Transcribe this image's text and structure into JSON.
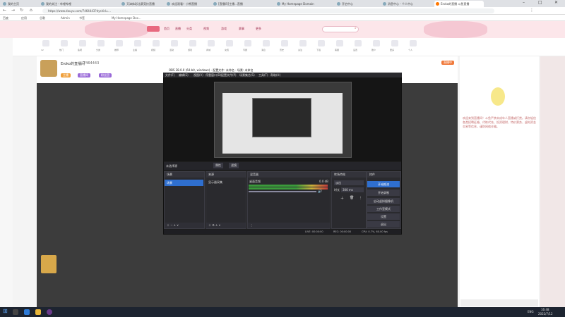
{
  "browser": {
    "tabs": [
      {
        "label": "我的主页"
      },
      {
        "label": "我的关注 - 哔哩哔哩"
      },
      {
        "label": "天津体彩比赛竞技直播"
      },
      {
        "label": "欢迎观看！小熊直播"
      },
      {
        "label": "[直播间]主播...直播"
      },
      {
        "label": "My Homepage Domain"
      },
      {
        "label": "开启中心"
      },
      {
        "label": "消息中心 - 个人中心"
      },
      {
        "label": "Eroko的直播 斗鱼直播"
      }
    ],
    "url": "https://www.douyu.com/7464443?dyshid=...",
    "bookmarks": [
      "百度",
      "应用",
      "谷歌",
      "Admin",
      "书签",
      "My Homepage Doc..."
    ]
  },
  "site": {
    "nav": [
      "首页",
      "直播",
      "分类",
      "视频",
      "游戏",
      "赛事",
      "更多"
    ],
    "icon_row": [
      "12",
      "热门",
      "鱼吧",
      "分类",
      "推荐",
      "主播",
      "视频",
      "活动",
      "游戏",
      "商城",
      "充值",
      "专属",
      "消息",
      "历史",
      "关注",
      "下载",
      "客服",
      "设置",
      "账户",
      "更多",
      "个人"
    ],
    "room": {
      "name": "Eroko的直播间",
      "id": "7464443",
      "tag1": "主播",
      "tag2": "直播间",
      "tag3": "粉丝团"
    },
    "side_text": "欢迎来到直播间！斗鱼严禁未成年人直播或打赏。请勿轻信各类招聘征婚、代练代充、投资理财、特价票务、虚拟资金交易等信息，谨防网络诈骗。",
    "live_badge": "直播中"
  },
  "obs": {
    "title": "OBS 28.0.0 (64-bit, windows) - 配置文件: 未命名 - 场景: 未命名",
    "menu": [
      "文件(F)",
      "编辑(E)",
      "视图(V)",
      "停靠窗口(D)",
      "配置文件(P)",
      "场景集合(S)",
      "工具(T)",
      "帮助(H)"
    ],
    "source_bar": {
      "label": "未选择源",
      "props": "属性",
      "filters": "滤镜"
    },
    "docks": {
      "scenes": "场景",
      "sources": "来源",
      "mixer": "混音器",
      "transitions": "转场特效",
      "controls": "控件"
    },
    "scene_item": "场景",
    "source_item": "显示器采集",
    "mixer_item": "桌面音频",
    "mixer_db": "0.0 dB",
    "transition": {
      "type": "淡出",
      "duration_label": "时长",
      "duration": "300 ms"
    },
    "controls": [
      "开始推流",
      "开始录制",
      "启动虚拟摄像机",
      "工作室模式",
      "设置",
      "退出"
    ],
    "status": {
      "live": "LIVE: 00:00:00",
      "rec": "REC: 00:00:00",
      "cpu": "CPU: 0.7%, 60.00 fps"
    }
  },
  "taskbar": {
    "time": "16:48",
    "date": "2022/7/12",
    "lang": "ENG"
  }
}
